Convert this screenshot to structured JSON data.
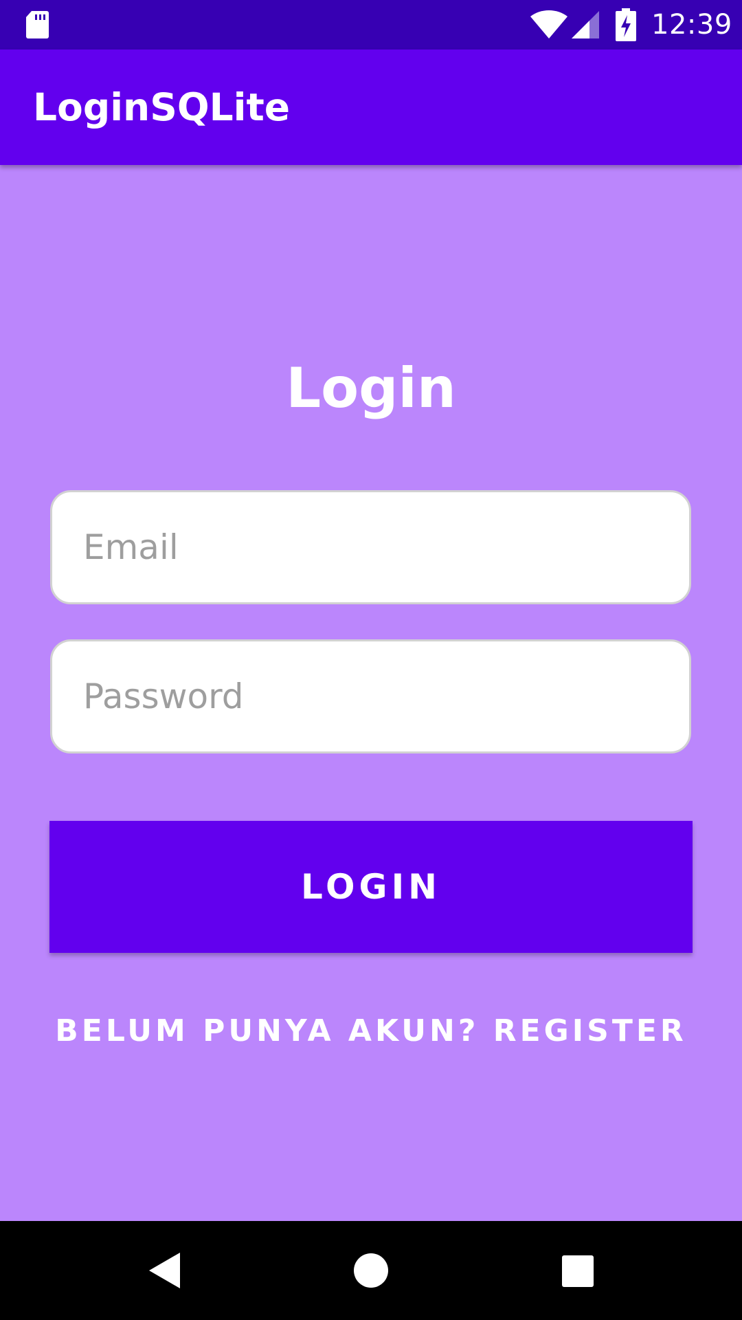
{
  "status_bar": {
    "time": "12:39",
    "icons": [
      "sd-card-icon",
      "wifi-icon",
      "signal-icon",
      "battery-charging-icon"
    ]
  },
  "toolbar": {
    "title": "LoginSQLite"
  },
  "login_form": {
    "heading": "Login",
    "email": {
      "value": "",
      "placeholder": "Email"
    },
    "password": {
      "value": "",
      "placeholder": "Password"
    },
    "login_button_label": "LOGIN",
    "register_link_label": "BELUM PUNYA AKUN? REGISTER"
  },
  "nav_bar": {
    "icons": [
      "back-icon",
      "home-icon",
      "recents-icon"
    ]
  },
  "colors": {
    "status_bar": "#3700b3",
    "toolbar": "#6200ee",
    "background": "#bb86fc",
    "button": "#6200ee",
    "nav_bar": "#000000"
  }
}
